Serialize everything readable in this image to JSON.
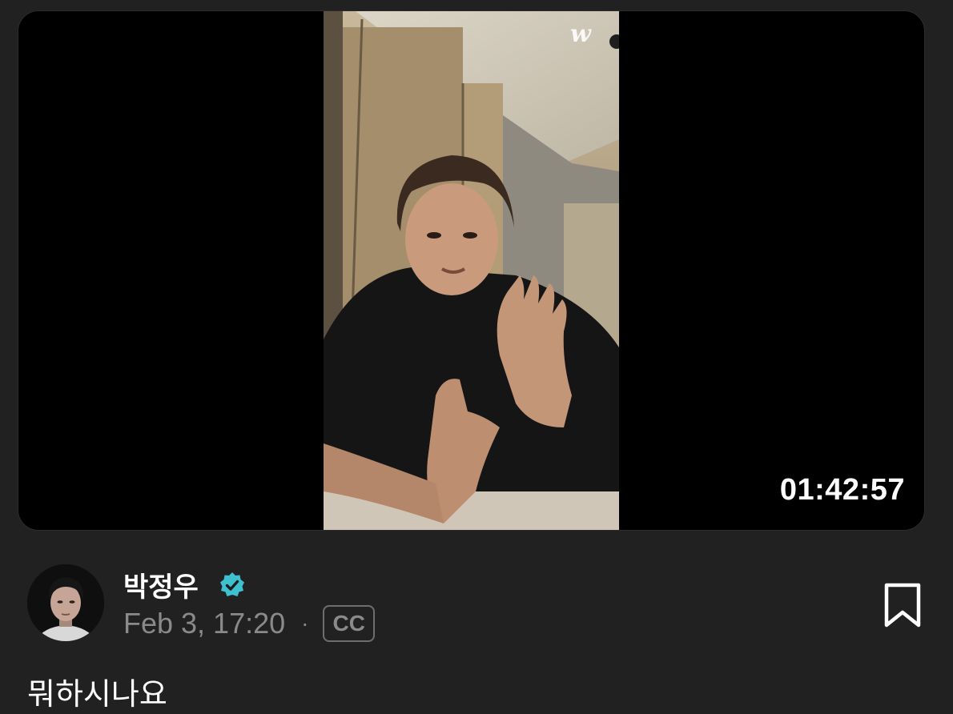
{
  "video": {
    "duration": "01:42:57",
    "watermark_icon": "weverse-w-logo"
  },
  "post": {
    "author_name": "박정우",
    "verified_icon": "verified-badge-icon",
    "date": "Feb 3, 17:20",
    "separator": "·",
    "cc_label": "CC",
    "caption": "뭐하시나요",
    "bookmark_icon": "bookmark-icon"
  },
  "colors": {
    "background": "#212121",
    "verified": "#3fc0cf",
    "muted_text": "#8a8a8a"
  }
}
